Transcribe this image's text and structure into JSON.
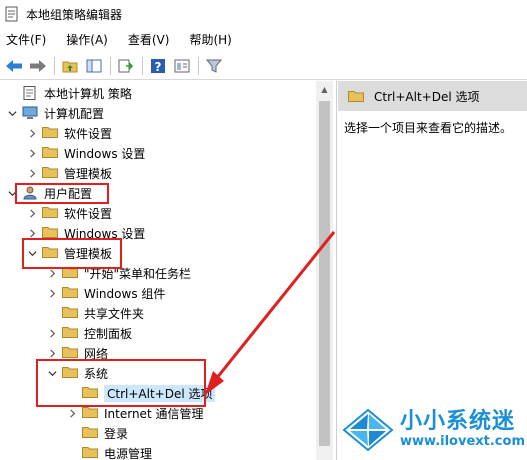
{
  "window": {
    "title": "本地组策略编辑器"
  },
  "menu": [
    "文件(F)",
    "操作(A)",
    "查看(V)",
    "帮助(H)"
  ],
  "toolbar": {
    "icons": [
      "back-icon",
      "forward-icon",
      "up-folder-icon",
      "show-hide-tree-icon",
      "export-list-icon",
      "help-icon",
      "properties-icon",
      "filter-icon"
    ]
  },
  "tree": [
    {
      "label": "本地计算机 策略",
      "icon": "policy-icon",
      "chev": "none"
    },
    {
      "label": "计算机配置",
      "icon": "computer-icon",
      "chev": "down"
    },
    {
      "label": "软件设置",
      "icon": "folder",
      "chev": "right"
    },
    {
      "label": "Windows 设置",
      "icon": "folder",
      "chev": "right"
    },
    {
      "label": "管理模板",
      "icon": "folder",
      "chev": "right"
    },
    {
      "label": "用户配置",
      "icon": "user-icon",
      "chev": "down"
    },
    {
      "label": "软件设置",
      "icon": "folder",
      "chev": "right"
    },
    {
      "label": "Windows 设置",
      "icon": "folder",
      "chev": "right"
    },
    {
      "label": "管理模板",
      "icon": "folder",
      "chev": "down"
    },
    {
      "label": "\"开始\"菜单和任务栏",
      "icon": "folder",
      "chev": "right"
    },
    {
      "label": "Windows 组件",
      "icon": "folder",
      "chev": "right"
    },
    {
      "label": "共享文件夹",
      "icon": "folder",
      "chev": "none"
    },
    {
      "label": "控制面板",
      "icon": "folder",
      "chev": "right"
    },
    {
      "label": "网络",
      "icon": "folder",
      "chev": "right"
    },
    {
      "label": "系统",
      "icon": "folder",
      "chev": "down"
    },
    {
      "label": "Ctrl+Alt+Del 选项",
      "icon": "folder",
      "chev": "none",
      "selected": true
    },
    {
      "label": "Internet 通信管理",
      "icon": "folder",
      "chev": "right"
    },
    {
      "label": "登录",
      "icon": "folder",
      "chev": "none"
    },
    {
      "label": "电源管理",
      "icon": "folder",
      "chev": "none"
    }
  ],
  "details": {
    "header": "Ctrl+Alt+Del 选项",
    "description": "选择一个项目来查看它的描述。"
  },
  "colors": {
    "callout": "#e02020",
    "selection": "#cce8ff",
    "folder": "#e8c15a",
    "brand": "#1a8fd6"
  },
  "watermark": {
    "title": "小小系统迷",
    "url": "www.ilovext.com"
  }
}
